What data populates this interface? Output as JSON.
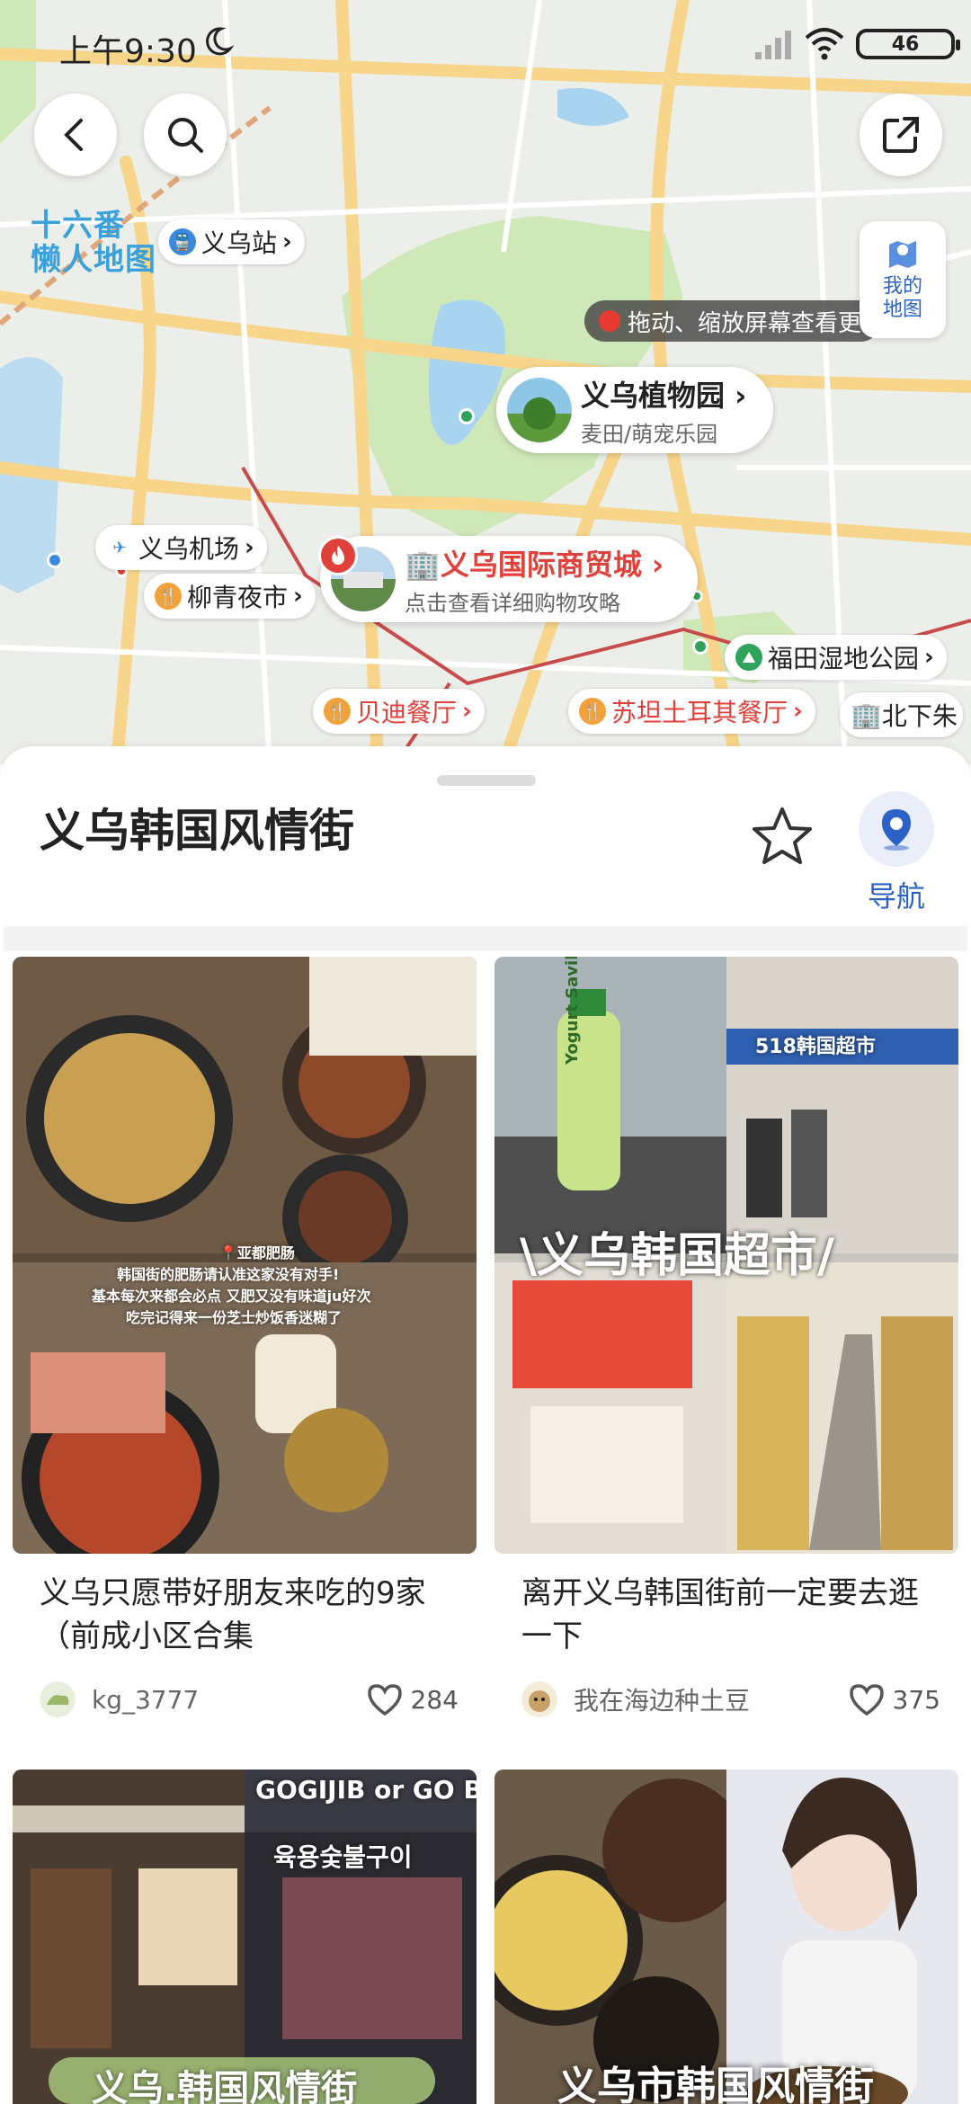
{
  "status": {
    "time": "上午9:30",
    "battery": "46"
  },
  "map": {
    "logo_line1": "十六番",
    "logo_line2": "懒人地图",
    "my_map_label": "我的地图",
    "tip": "拖动、缩放屏幕查看更",
    "pins": {
      "station": "义乌站",
      "airport": "义乌机场",
      "night_market": "柳青夜市",
      "wetland": "福田湿地公园",
      "beidi": "贝迪餐厅",
      "sudan": "苏坦土耳其餐厅",
      "beixia": "北下朱"
    },
    "garden": {
      "title": "义乌植物园",
      "subtitle": "麦田/萌宠乐园"
    },
    "trade": {
      "title": "义乌国际商贸城",
      "subtitle": "点击查看详细购物攻略"
    },
    "colors": {
      "water": "#a9d4f0",
      "park": "#cfe8b8",
      "road": "#f7d58a",
      "rail": "#c94a4a"
    }
  },
  "sheet": {
    "title": "义乌韩国风情街",
    "nav_label": "导航"
  },
  "posts": [
    {
      "title": "义乌只愿带好朋友来吃的9家（前成小区合集",
      "author": "kg_3777",
      "likes": "284",
      "overlay_lines": [
        "📍亚都肥肠",
        "韩国街的肥肠请认准这家没有对手!",
        "基本每次来都会必点 又肥又没有味道ju好次",
        "吃完记得来一份芝士炒饭香迷糊了"
      ]
    },
    {
      "title": "离开义乌韩国街前一定要去逛一下",
      "author": "我在海边种土豆",
      "likes": "375",
      "overlay_title": "\\义乌韩国超市/",
      "shop_sign": "518韩国超市",
      "bottle_text": "Yogurt Savila"
    },
    {
      "overlay_title": "义乌.韩国风情街",
      "sign": "GOGIJIB or GO BB",
      "sign2": "육용숯불구이"
    },
    {
      "overlay_title": "义乌市韩国风情街"
    }
  ],
  "icons": [
    "back-icon",
    "search-icon",
    "share-icon",
    "map-pin-icon",
    "star-icon",
    "navigate-icon",
    "heart-icon",
    "moon-icon",
    "wifi-icon",
    "signal-icon"
  ]
}
